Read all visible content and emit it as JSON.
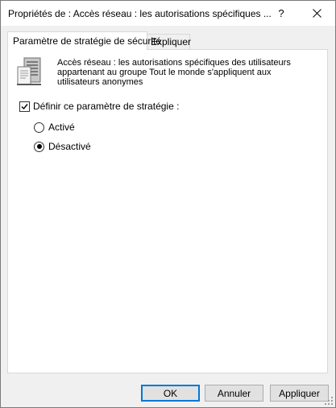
{
  "window": {
    "title": "Propriétés de : Accès réseau : les autorisations spécifiques ...",
    "help_label": "?",
    "close_icon": "close-icon"
  },
  "tabs": [
    {
      "label": "Paramètre de stratégie de sécurité",
      "active": true
    },
    {
      "label": "Expliquer",
      "active": false
    }
  ],
  "panel": {
    "icon": "server-policy-icon",
    "description": "Accès réseau : les autorisations spécifiques des utilisateurs appartenant au groupe Tout le monde s'appliquent aux utilisateurs anonymes",
    "define_checkbox": {
      "label": "Définir ce paramètre de stratégie :",
      "checked": true
    },
    "options": [
      {
        "label": "Activé",
        "selected": false
      },
      {
        "label": "Désactivé",
        "selected": true
      }
    ]
  },
  "buttons": {
    "ok": "OK",
    "cancel": "Annuler",
    "apply": "Appliquer"
  },
  "colors": {
    "accent": "#0078d7",
    "panel_bg": "#ffffff",
    "window_bg": "#f0f0f0"
  }
}
